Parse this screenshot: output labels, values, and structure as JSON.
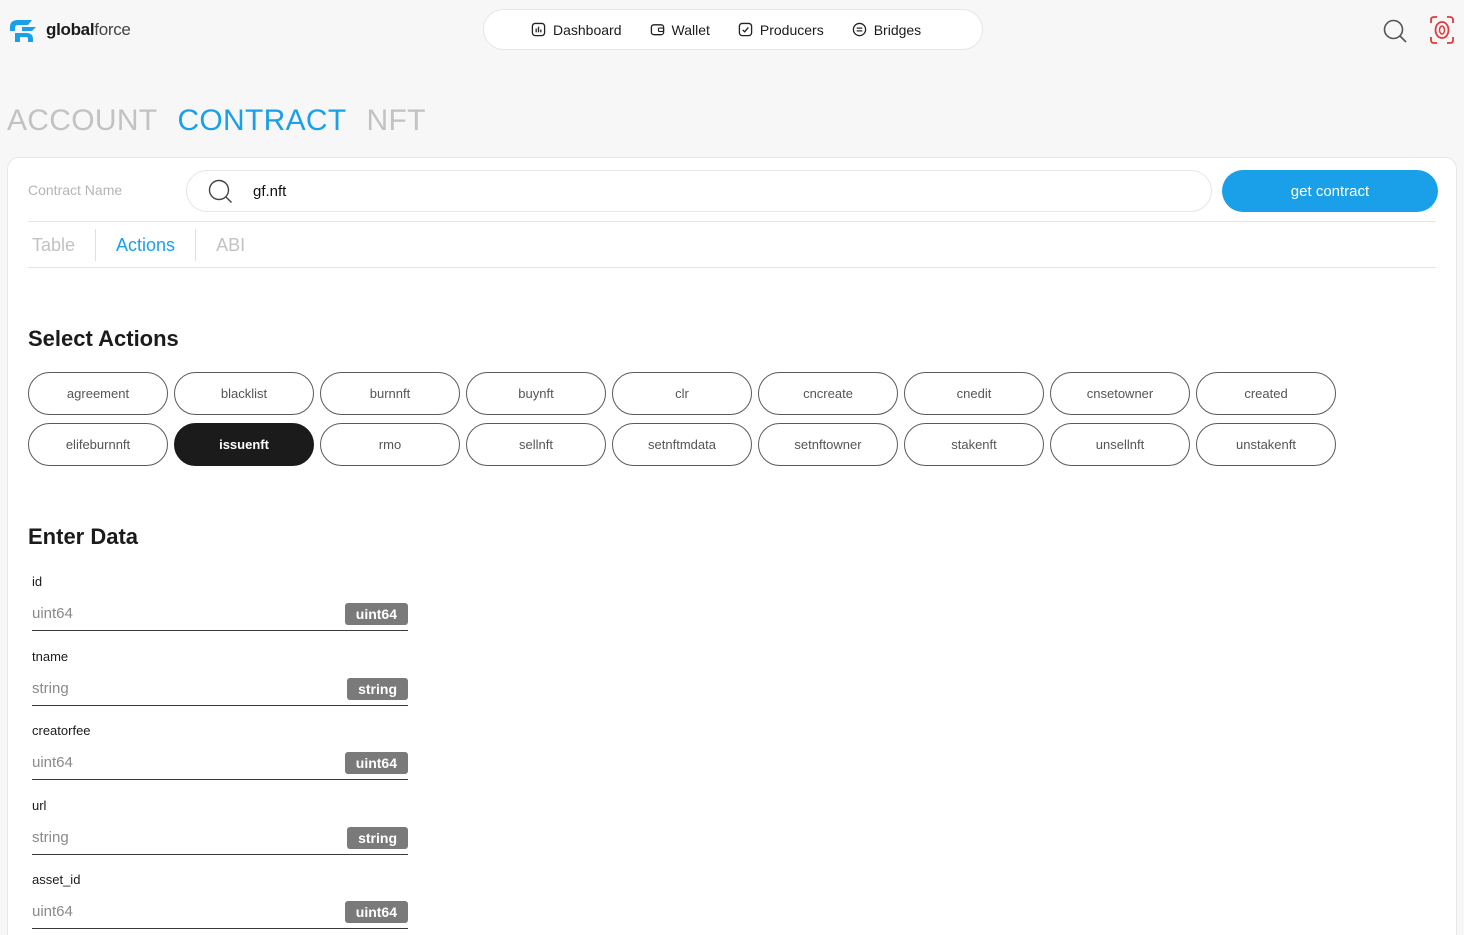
{
  "header": {
    "logo_bold": "global",
    "logo_light": "force",
    "brand_color": "#1aa0e8",
    "nav": [
      {
        "label": "Dashboard",
        "icon": "dashboard-icon"
      },
      {
        "label": "Wallet",
        "icon": "wallet-icon"
      },
      {
        "label": "Producers",
        "icon": "producers-icon"
      },
      {
        "label": "Bridges",
        "icon": "bridges-icon"
      }
    ]
  },
  "big_tabs": [
    "ACCOUNT",
    "CONTRACT",
    "NFT"
  ],
  "big_tab_active": "CONTRACT",
  "contract": {
    "label": "Contract Name",
    "value": "gf.nft",
    "button": "get contract"
  },
  "sub_tabs": [
    "Table",
    "Actions",
    "ABI"
  ],
  "sub_tab_active": "Actions",
  "select_actions_title": "Select Actions",
  "actions": [
    "agreement",
    "blacklist",
    "burnnft",
    "buynft",
    "clr",
    "cncreate",
    "cnedit",
    "cnsetowner",
    "created",
    "elifeburnnft",
    "issuenft",
    "rmo",
    "sellnft",
    "setnftmdata",
    "setnftowner",
    "stakenft",
    "unsellnft",
    "unstakenft"
  ],
  "action_active": "issuenft",
  "enter_data_title": "Enter Data",
  "fields": [
    {
      "name": "id",
      "placeholder": "uint64",
      "type": "uint64"
    },
    {
      "name": "tname",
      "placeholder": "string",
      "type": "string"
    },
    {
      "name": "creatorfee",
      "placeholder": "uint64",
      "type": "uint64"
    },
    {
      "name": "url",
      "placeholder": "string",
      "type": "string"
    },
    {
      "name": "asset_id",
      "placeholder": "uint64",
      "type": "uint64"
    }
  ]
}
